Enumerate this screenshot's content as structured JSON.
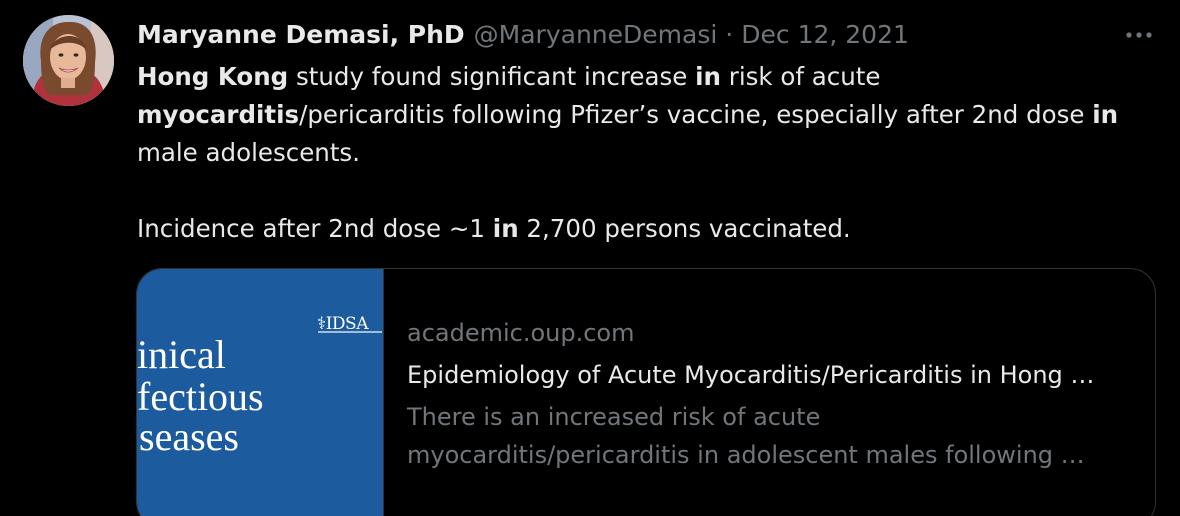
{
  "tweet": {
    "display_name": "Maryanne Demasi, PhD",
    "handle": "@MaryanneDemasi",
    "separator": "·",
    "date": "Dec 12, 2021",
    "body": {
      "line1": [
        {
          "text": "Hong Kong",
          "bold": true
        },
        {
          "text": " study found significant increase ",
          "bold": false
        },
        {
          "text": "in",
          "bold": true
        },
        {
          "text": " risk of acute",
          "bold": false
        }
      ],
      "line2": [
        {
          "text": "myocarditis",
          "bold": true
        },
        {
          "text": "/pericarditis following Pfizer’s vaccine, especially after 2nd dose ",
          "bold": false
        },
        {
          "text": "in",
          "bold": true
        }
      ],
      "line3": [
        {
          "text": "male adolescents.",
          "bold": false
        }
      ],
      "line4": [
        {
          "text": "Incidence after 2nd dose ~1 ",
          "bold": false
        },
        {
          "text": "in",
          "bold": true
        },
        {
          "text": " 2,700 persons vaccinated.",
          "bold": false
        }
      ]
    },
    "card": {
      "domain": "academic.oup.com",
      "title": "Epidemiology of Acute Myocarditis/Pericarditis in Hong …",
      "description_line1": "There is an increased risk of acute",
      "description_line2": "myocarditis/pericarditis in adolescent males following …",
      "thumbnail": {
        "logo_text": "IDSA",
        "word1": "inical",
        "word2": "fectious",
        "word3": "seases",
        "background": "#1b5b9e"
      }
    },
    "icons": {
      "more": "more-horizontal-icon",
      "avatar": "avatar"
    },
    "colors": {
      "background": "#000000",
      "text": "#e7e9ea",
      "secondary": "#71767b",
      "border": "#2f3336"
    }
  }
}
